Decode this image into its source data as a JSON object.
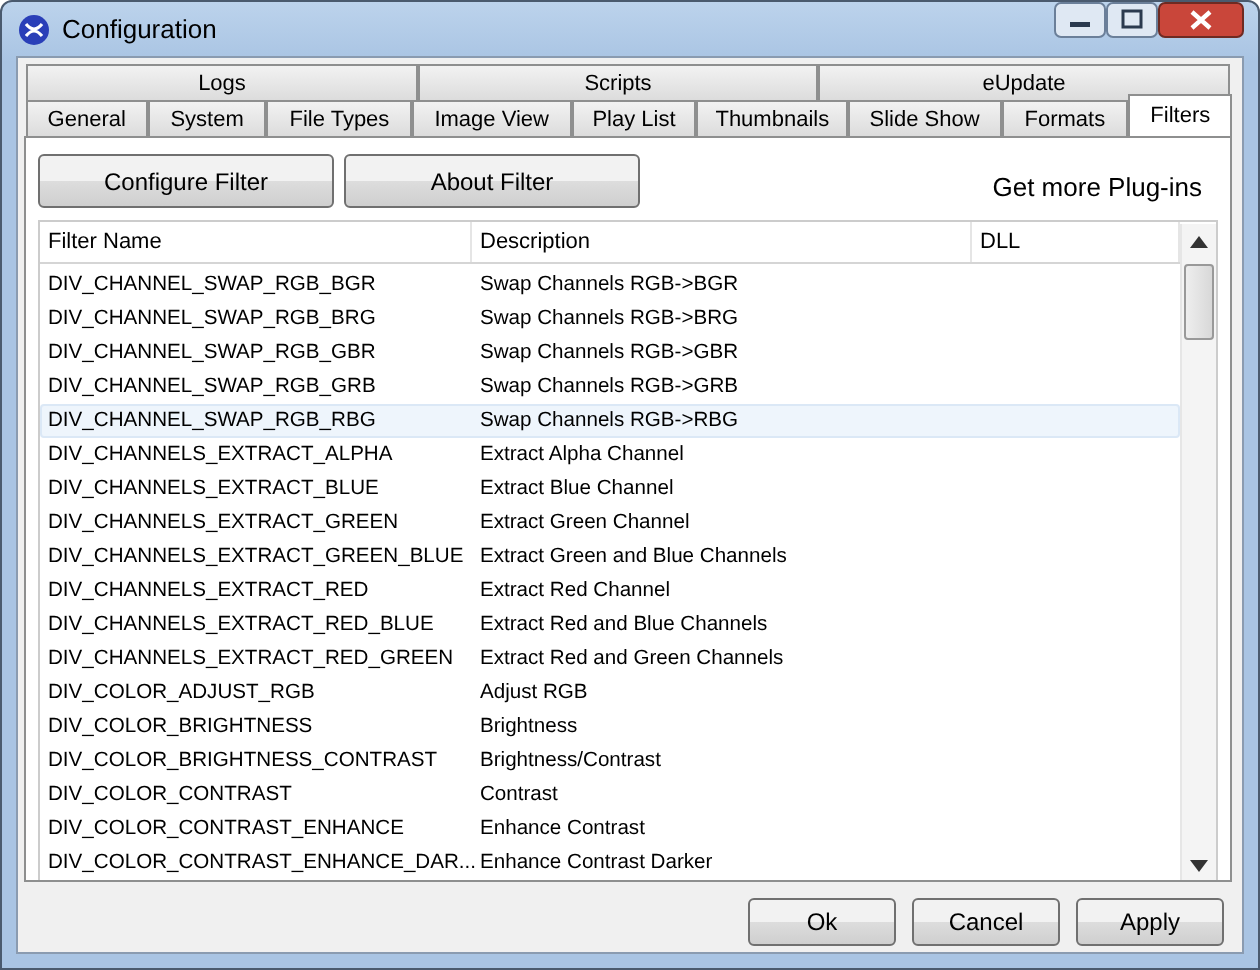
{
  "window": {
    "title": "Configuration"
  },
  "tab_rows": [
    [
      {
        "label": "Logs",
        "selected": false
      },
      {
        "label": "Scripts",
        "selected": false
      },
      {
        "label": "eUpdate",
        "selected": false
      }
    ],
    [
      {
        "label": "General",
        "selected": false
      },
      {
        "label": "System",
        "selected": false
      },
      {
        "label": "File Types",
        "selected": false
      },
      {
        "label": "Image View",
        "selected": false
      },
      {
        "label": "Play List",
        "selected": false
      },
      {
        "label": "Thumbnails",
        "selected": false
      },
      {
        "label": "Slide Show",
        "selected": false
      },
      {
        "label": "Formats",
        "selected": false
      },
      {
        "label": "Filters",
        "selected": true
      }
    ]
  ],
  "toolbar": {
    "buttons": [
      "Configure Filter",
      "About Filter"
    ],
    "link": "Get more Plug-ins"
  },
  "table": {
    "columns": [
      "Filter Name",
      "Description",
      "DLL"
    ],
    "rows": [
      {
        "name": "DIV_CHANNEL_SWAP_RGB_BGR",
        "description": "Swap Channels RGB->BGR",
        "selected": false
      },
      {
        "name": "DIV_CHANNEL_SWAP_RGB_BRG",
        "description": "Swap Channels RGB->BRG",
        "selected": false
      },
      {
        "name": "DIV_CHANNEL_SWAP_RGB_GBR",
        "description": "Swap Channels RGB->GBR",
        "selected": false
      },
      {
        "name": "DIV_CHANNEL_SWAP_RGB_GRB",
        "description": "Swap Channels RGB->GRB",
        "selected": false
      },
      {
        "name": "DIV_CHANNEL_SWAP_RGB_RBG",
        "description": "Swap Channels RGB->RBG",
        "selected": true
      },
      {
        "name": "DIV_CHANNELS_EXTRACT_ALPHA",
        "description": "Extract Alpha Channel",
        "selected": false
      },
      {
        "name": "DIV_CHANNELS_EXTRACT_BLUE",
        "description": "Extract Blue Channel",
        "selected": false
      },
      {
        "name": "DIV_CHANNELS_EXTRACT_GREEN",
        "description": "Extract Green Channel",
        "selected": false
      },
      {
        "name": "DIV_CHANNELS_EXTRACT_GREEN_BLUE",
        "description": "Extract Green and Blue Channels",
        "selected": false
      },
      {
        "name": "DIV_CHANNELS_EXTRACT_RED",
        "description": "Extract Red Channel",
        "selected": false
      },
      {
        "name": "DIV_CHANNELS_EXTRACT_RED_BLUE",
        "description": "Extract Red and Blue Channels",
        "selected": false
      },
      {
        "name": "DIV_CHANNELS_EXTRACT_RED_GREEN",
        "description": "Extract Red and Green Channels",
        "selected": false
      },
      {
        "name": "DIV_COLOR_ADJUST_RGB",
        "description": "Adjust RGB",
        "selected": false
      },
      {
        "name": "DIV_COLOR_BRIGHTNESS",
        "description": "Brightness",
        "selected": false
      },
      {
        "name": "DIV_COLOR_BRIGHTNESS_CONTRAST",
        "description": "Brightness/Contrast",
        "selected": false
      },
      {
        "name": "DIV_COLOR_CONTRAST",
        "description": "Contrast",
        "selected": false
      },
      {
        "name": "DIV_COLOR_CONTRAST_ENHANCE",
        "description": "Enhance Contrast",
        "selected": false
      },
      {
        "name": "DIV_COLOR_CONTRAST_ENHANCE_DAR...",
        "description": "Enhance Contrast Darker",
        "selected": false
      }
    ]
  },
  "buttons": [
    "Ok",
    "Cancel",
    "Apply"
  ]
}
